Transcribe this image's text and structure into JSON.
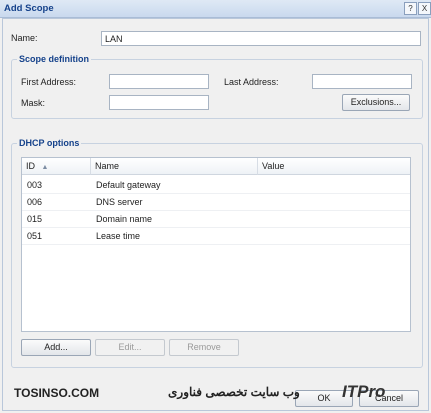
{
  "window": {
    "title": "Add Scope",
    "help_glyph": "?",
    "close_glyph": "X"
  },
  "name_field": {
    "label": "Name:",
    "value": "LAN"
  },
  "scope_definition": {
    "title": "Scope definition",
    "first_address_label": "First Address:",
    "last_address_label": "Last Address:",
    "mask_label": "Mask:",
    "exclusions_button": "Exclusions..."
  },
  "dhcp_options": {
    "title": "DHCP options",
    "columns": [
      "ID",
      "Name",
      "Value"
    ],
    "rows": [
      {
        "id": "003",
        "name": "Default gateway",
        "value": ""
      },
      {
        "id": "006",
        "name": "DNS server",
        "value": ""
      },
      {
        "id": "015",
        "name": "Domain name",
        "value": ""
      },
      {
        "id": "051",
        "name": "Lease time",
        "value": ""
      }
    ],
    "add_button": "Add...",
    "edit_button": "Edit...",
    "remove_button": "Remove"
  },
  "footer": {
    "ok_button": "OK",
    "cancel_button": "Cancel"
  },
  "watermark": {
    "left_text": "TOSINSO.COM",
    "right_text": "ITPro",
    "arabic_text": "وب سایت تخصصی فناوری"
  },
  "colors": {
    "title": "#15428b",
    "accent": "#c9d9ee"
  }
}
